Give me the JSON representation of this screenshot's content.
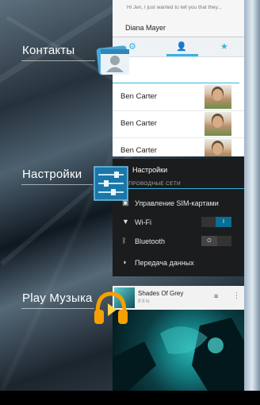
{
  "apps": [
    {
      "label": "Контакты",
      "icon": "contacts-icon"
    },
    {
      "label": "Настройки",
      "icon": "settings-icon"
    },
    {
      "label": "Play Музыка",
      "icon": "headphones-icon"
    }
  ],
  "email": {
    "preview": "Hi Jen, I just wanted to tell you that they...",
    "sender": "Diana Mayer"
  },
  "contacts": {
    "tabs": [
      "groups-icon",
      "person-icon",
      "star-icon"
    ],
    "rows": [
      "Ben Carter",
      "Ben Carter",
      "Ben Carter"
    ]
  },
  "settings": {
    "title": "Настройки",
    "section": "БЕСПРОВОДНЫЕ СЕТИ",
    "rows": [
      {
        "label": "Управление SIM-картами",
        "icon": "sim-icon"
      },
      {
        "label": "Wi-Fi",
        "icon": "wifi-icon",
        "toggle": "I"
      },
      {
        "label": "Bluetooth",
        "icon": "bluetooth-icon",
        "toggle": "O"
      },
      {
        "label": "Передача данных",
        "icon": "data-usage-icon"
      }
    ]
  },
  "music": {
    "title": "Shades Of Grey",
    "artist": "If It Is"
  },
  "colors": {
    "accent": "#33b5e5",
    "music_orange": "#f5a000"
  }
}
